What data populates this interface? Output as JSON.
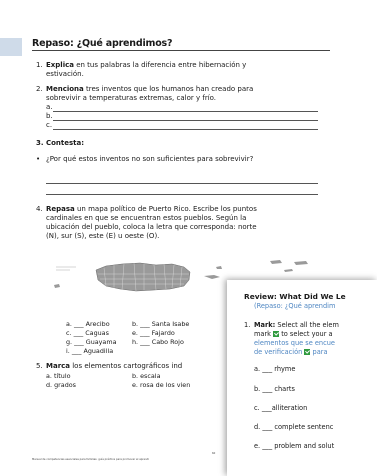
{
  "doc1": {
    "title": "Repaso: ¿Qué aprendimos?",
    "q1": {
      "num": "1.",
      "bold": "Explica",
      "rest": " en tus palabras la diferencia entre hibernación y",
      "line2": "estivación."
    },
    "q2": {
      "num": "2.",
      "bold": "Menciona",
      "rest": " tres inventos que los humanos han creado para",
      "line2": "sobrevivir a temperaturas extremas, calor y frío.",
      "a": "a.",
      "b": "b.",
      "c": "c."
    },
    "q3": {
      "heading": "3. Contesta:",
      "bullet": "•",
      "question": "¿Por qué estos inventos no son suficientes para sobrevivir?"
    },
    "q4": {
      "num": "4.",
      "bold": "Repasa",
      "rest": " un mapa político de Puerto Rico. Escribe los puntos",
      "line2": "cardinales en que se encuentran estos pueblos. Según la",
      "line3": "ubicación del pueblo, coloca la letra que corresponda: norte",
      "line4": "(N), sur (S), este (E) u oeste (O)."
    },
    "towns": {
      "a": "a. ___ Arecibo",
      "b": "b. ___ Santa Isabe",
      "c": "c. ___ Caguas",
      "e": "e. ___ Fajardo",
      "g": "g. ___ Guayama",
      "h": "h. ___ Cabo Rojo",
      "i": "i. ___ Aguadilla"
    },
    "q5": {
      "num": "5.",
      "bold": "Marca",
      "rest": " los elementos cartográficos ind",
      "a": "a. título",
      "b": "b. escala",
      "d": "d. grados",
      "e": "e. rosa de los vien"
    },
    "page_num": "60",
    "footer": "Manual de competencias esenciales para familias: guía práctica para promover el aprendi"
  },
  "doc2": {
    "title": "Review: What Did We Le",
    "subtitle": "(Repaso: ¿Qué aprendim",
    "q1": {
      "num": "1.",
      "bold": "Mark:",
      "rest": " Select all the elem",
      "line2a": "mark",
      "line2b": " to select your a",
      "line3": "elementos que se encue",
      "line4": "de verificación",
      "line4b": " para"
    },
    "options": [
      "a. ___ rhyme",
      "b. ___ charts",
      "c. ___alliteration",
      "d. ___ complete sentenc",
      "e. ___ problem and solut"
    ],
    "colors": {
      "blue": "#4e86c2",
      "check": "#2f9a3e",
      "band": "#cfdbe9"
    },
    "icons": [
      "green-checkbox-icon"
    ]
  }
}
